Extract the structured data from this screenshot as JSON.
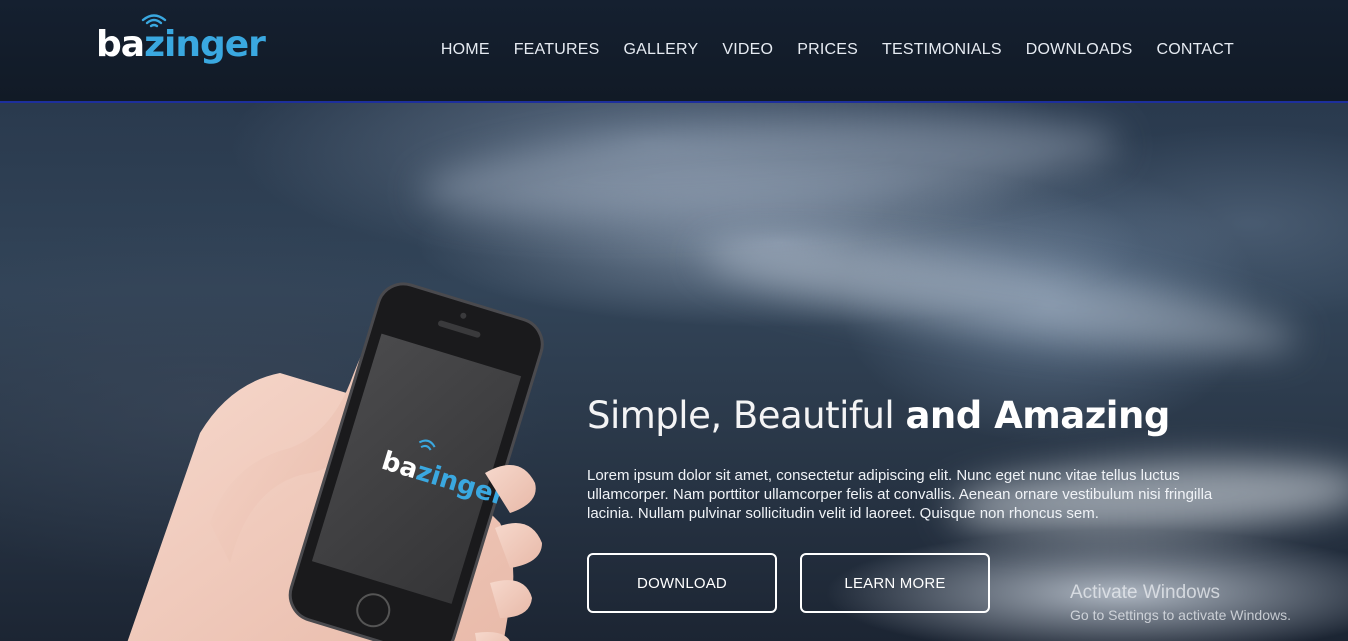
{
  "header": {
    "logo": {
      "part1": "ba",
      "part2": "zinger"
    },
    "nav": [
      {
        "label": "HOME"
      },
      {
        "label": "FEATURES"
      },
      {
        "label": "GALLERY"
      },
      {
        "label": "VIDEO"
      },
      {
        "label": "PRICES"
      },
      {
        "label": "TESTIMONIALS"
      },
      {
        "label": "DOWNLOADS"
      },
      {
        "label": "CONTACT"
      }
    ]
  },
  "hero": {
    "title_light": "Simple, Beautiful ",
    "title_bold": "and Amazing",
    "text": "Lorem ipsum dolor sit amet, consectetur adipiscing elit. Nunc eget nunc vitae tellus luctus ullamcorper. Nam porttitor ullamcorper felis at convallis. Aenean ornare vestibulum nisi fringilla lacinia. Nullam pulvinar sollicitudin velit id laoreet. Quisque non rhoncus sem.",
    "download_label": "DOWNLOAD",
    "learn_more_label": "LEARN MORE",
    "phone_logo": {
      "part1": "ba",
      "part2": "zinger"
    }
  },
  "watermark": {
    "line1": "Activate Windows",
    "line2": "Go to Settings to activate Windows."
  },
  "colors": {
    "accent": "#3aa8e0",
    "header_bg": "#131d2a",
    "header_border": "#1d2f9c"
  }
}
